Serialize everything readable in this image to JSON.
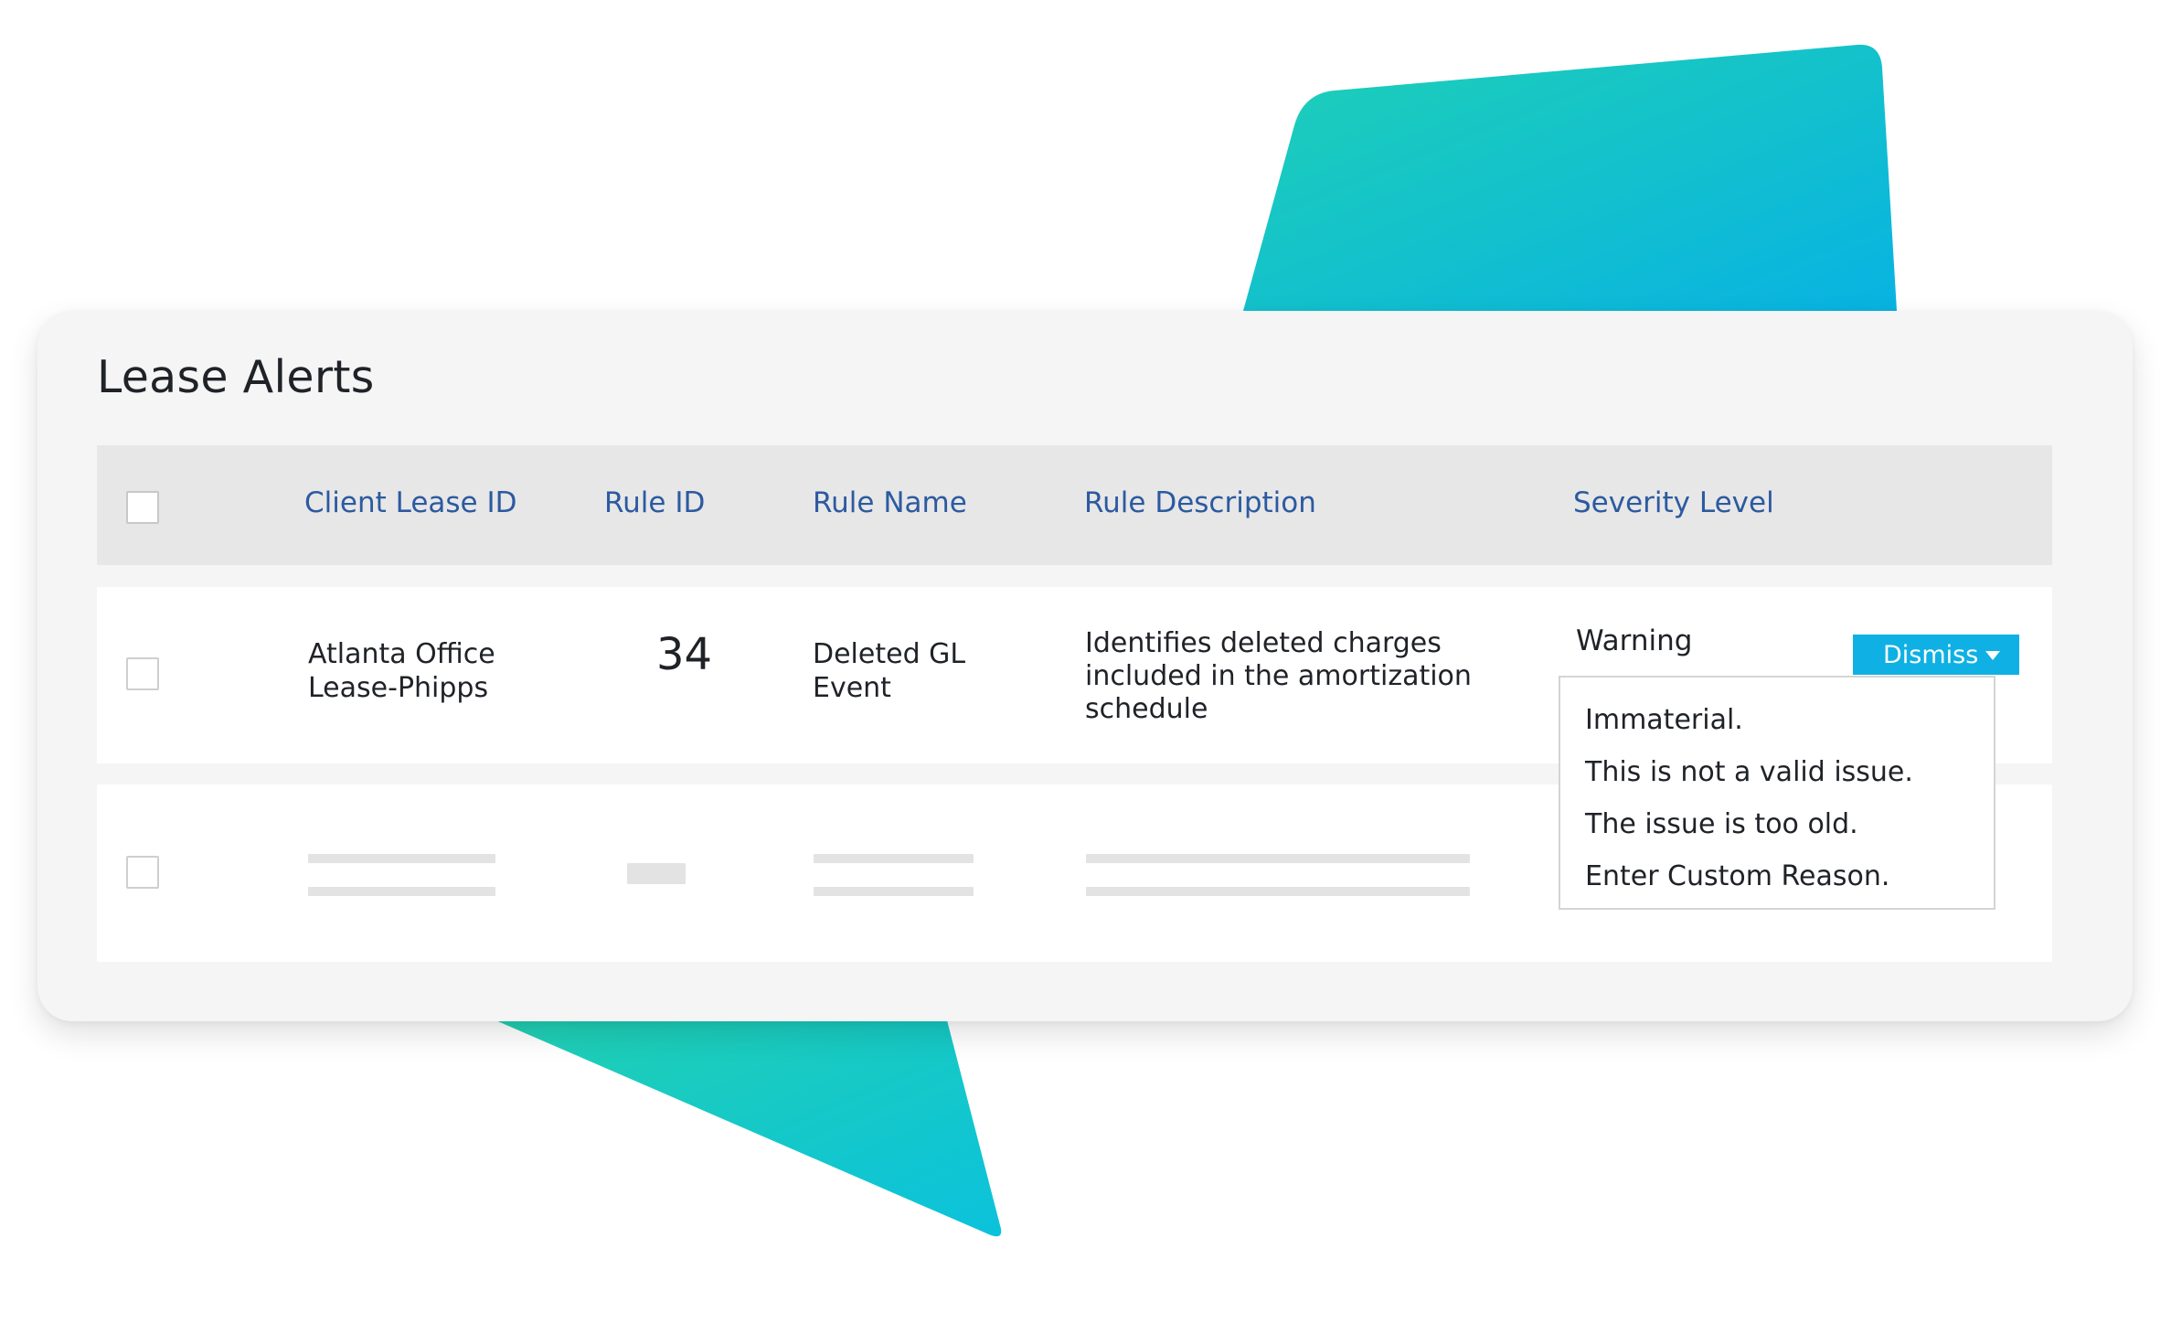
{
  "page": {
    "title": "Lease Alerts"
  },
  "table": {
    "columns": [
      "Client Lease ID",
      "Rule ID",
      "Rule Name",
      "Rule Description",
      "Severity Level"
    ],
    "rows": [
      {
        "client_lease_id": "Atlanta Office Lease-Phipps",
        "rule_id": "34",
        "rule_name": "Deleted GL Event",
        "rule_description": "Identifies deleted charges included in the amortization schedule",
        "severity_level": "Warning"
      }
    ]
  },
  "actions": {
    "dismiss_label": "Dismiss",
    "dismiss_options": [
      "Immaterial.",
      "This is not a valid issue.",
      "The issue is too old.",
      "Enter Custom Reason."
    ]
  },
  "colors": {
    "accent": "#0fb0e4",
    "header_text": "#2c5aa0",
    "gradient_start": "#1fd0b5",
    "gradient_end": "#08b3e2"
  }
}
